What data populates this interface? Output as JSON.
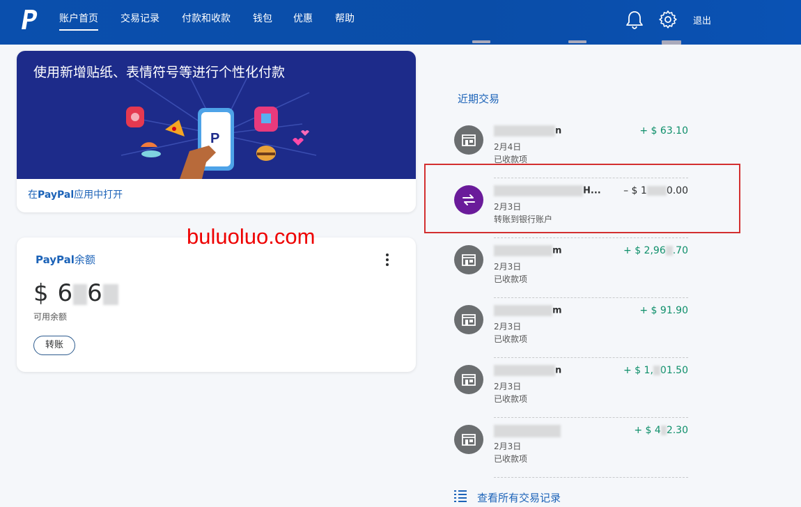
{
  "nav": {
    "tabs": [
      {
        "label": "账户首页",
        "active": true
      },
      {
        "label": "交易记录"
      },
      {
        "label": "付款和收款"
      },
      {
        "label": "钱包"
      },
      {
        "label": "优惠"
      },
      {
        "label": "帮助"
      }
    ],
    "logout_label": "退出",
    "icons": [
      "paypal-logo-icon",
      "bell-icon",
      "gear-icon"
    ]
  },
  "promo": {
    "title": "使用新增贴纸、表情符号等进行个性化付款",
    "link_prefix": "在",
    "link_brand": "PayPal",
    "link_suffix": "应用中打开"
  },
  "balance": {
    "brand": "PayPal",
    "title_suffix": "余额",
    "currency": "$",
    "amount_visible_start": "6",
    "amount_visible_end": "6",
    "sub_label": "可用余额",
    "transfer_label": "转账"
  },
  "watermark": "buluoluo.com",
  "transactions": {
    "title": "近期交易",
    "items": [
      {
        "name_visible_end": "n",
        "date": "2月4日",
        "status": "已收款项",
        "amount": "+ $ 63.10",
        "type": "shop-icon"
      },
      {
        "name_visible_end": "H...",
        "date": "2月3日",
        "status": "转账到银行账户",
        "amount_prefix": "– $ 1",
        "amount_suffix": "0.00",
        "type": "transfer-icon"
      },
      {
        "name_visible_end": "m",
        "date": "2月3日",
        "status": "已收款项",
        "amount_prefix": "+ $ 2,96",
        "amount_suffix": ".70",
        "type": "shop-icon"
      },
      {
        "name_visible_end": "m",
        "date": "2月3日",
        "status": "已收款项",
        "amount": "+ $ 91.90",
        "type": "shop-icon"
      },
      {
        "name_visible_end": "n",
        "date": "2月3日",
        "status": "已收款项",
        "amount_prefix": "+ $ 1,",
        "amount_suffix": "01.50",
        "type": "shop-icon"
      },
      {
        "name_visible_end": "",
        "date": "2月3日",
        "status": "已收款项",
        "amount_prefix": "+ $ 4",
        "amount_suffix": "2.30",
        "type": "shop-icon"
      }
    ],
    "view_all_label": "查看所有交易记录"
  },
  "colors": {
    "nav_bg": "#0a4fad",
    "link": "#1c63b8",
    "positive": "#0e8f6a",
    "transfer_avatar": "#6a1b9a",
    "highlight": "#d32f2f",
    "watermark": "#ee0000"
  }
}
